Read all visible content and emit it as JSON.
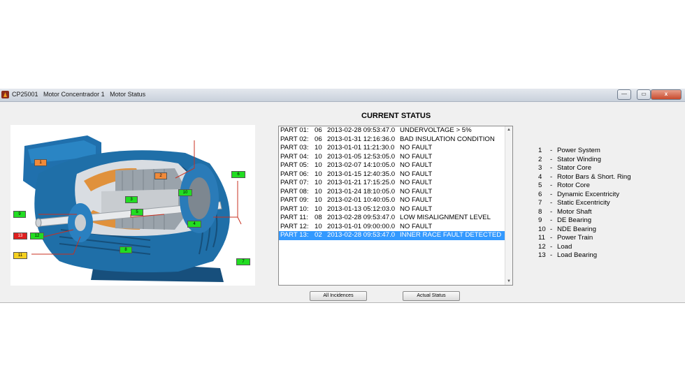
{
  "window": {
    "title": "CP25001   Motor Concentrador 1   Motor Status",
    "controls": {
      "minimize": "—",
      "maximize": "▭",
      "close": "x"
    }
  },
  "status_heading": "CURRENT STATUS",
  "motor_tags": [
    "1",
    "2",
    "3",
    "4",
    "5",
    "6",
    "7",
    "8",
    "9",
    "10",
    "11",
    "12",
    "13"
  ],
  "status_rows": [
    {
      "part": "PART 01:",
      "code": "06",
      "timestamp": "2013-02-28 09:53:47.0",
      "status": "UNDERVOLTAGE > 5%",
      "selected": false
    },
    {
      "part": "PART 02:",
      "code": "06",
      "timestamp": "2013-01-31 12:16:36.0",
      "status": "BAD INSULATION CONDITION",
      "selected": false
    },
    {
      "part": "PART 03:",
      "code": "10",
      "timestamp": "2013-01-01 11:21:30.0",
      "status": "NO FAULT",
      "selected": false
    },
    {
      "part": "PART 04:",
      "code": "10",
      "timestamp": "2013-01-05 12:53:05.0",
      "status": "NO FAULT",
      "selected": false
    },
    {
      "part": "PART 05:",
      "code": "10",
      "timestamp": "2013-02-07 14:10:05.0",
      "status": "NO FAULT",
      "selected": false
    },
    {
      "part": "PART 06:",
      "code": "10",
      "timestamp": "2013-01-15 12:40:35.0",
      "status": "NO FAULT",
      "selected": false
    },
    {
      "part": "PART 07:",
      "code": "10",
      "timestamp": "2013-01-21 17:15:25.0",
      "status": "NO FAULT",
      "selected": false
    },
    {
      "part": "PART 08:",
      "code": "10",
      "timestamp": "2013-01-24 18:10:05.0",
      "status": "NO FAULT",
      "selected": false
    },
    {
      "part": "PART 09:",
      "code": "10",
      "timestamp": "2013-02-01 10:40:05.0",
      "status": "NO FAULT",
      "selected": false
    },
    {
      "part": "PART 10:",
      "code": "10",
      "timestamp": "2013-01-13 05:12:03.0",
      "status": "NO FAULT",
      "selected": false
    },
    {
      "part": "PART 11:",
      "code": "08",
      "timestamp": "2013-02-28 09:53:47.0",
      "status": "LOW MISALIGNMENT LEVEL",
      "selected": false
    },
    {
      "part": "PART 12:",
      "code": "10",
      "timestamp": "2013-01-01 09:00:00.0",
      "status": "NO FAULT",
      "selected": false
    },
    {
      "part": "PART 13:",
      "code": "02",
      "timestamp": "2013-02-28 09:53:47.0",
      "status": "INNER RACE FAULT DETECTED",
      "selected": true
    }
  ],
  "legend": [
    {
      "num": "1",
      "label": "Power System"
    },
    {
      "num": "2",
      "label": "Stator Winding"
    },
    {
      "num": "3",
      "label": "Stator Core"
    },
    {
      "num": "4",
      "label": "Rotor Bars & Short. Ring"
    },
    {
      "num": "5",
      "label": "Rotor Core"
    },
    {
      "num": "6",
      "label": "Dynamic Excentricity"
    },
    {
      "num": "7",
      "label": "Static Excentricity"
    },
    {
      "num": "8",
      "label": "Motor Shaft"
    },
    {
      "num": "9",
      "label": "DE Bearing"
    },
    {
      "num": "10",
      "label": "NDE Bearing"
    },
    {
      "num": "11",
      "label": "Power Train"
    },
    {
      "num": "12",
      "label": "Load"
    },
    {
      "num": "13",
      "label": "Load Bearing"
    }
  ],
  "buttons": {
    "all_incidences": "All Incidences",
    "actual_status": "Actual Status"
  },
  "colors": {
    "selection": "#3399ff",
    "tag_ok": "#22dd22",
    "tag_warning": "#f08a3a",
    "tag_alert": "#f5d020",
    "tag_fault": "#e02020",
    "motor_body": "#1f6fa8"
  }
}
